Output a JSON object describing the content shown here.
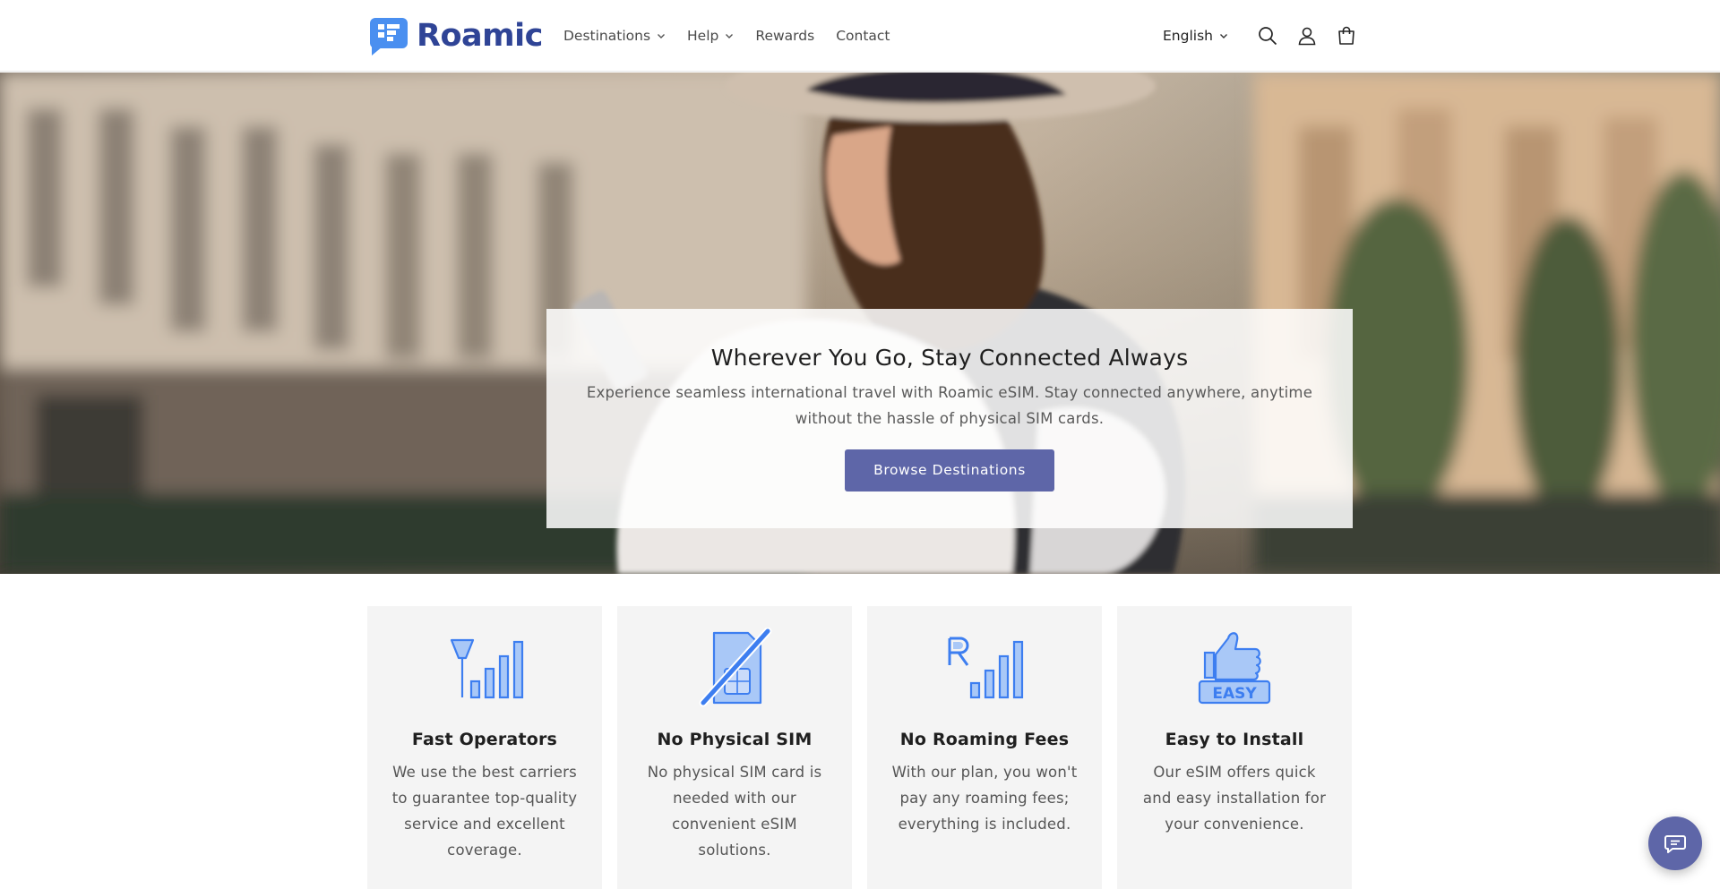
{
  "brand": {
    "name": "Roamic",
    "color": "#2f4496"
  },
  "nav": {
    "items": [
      {
        "label": "Destinations",
        "has_dropdown": true
      },
      {
        "label": "Help",
        "has_dropdown": true
      },
      {
        "label": "Rewards",
        "has_dropdown": false
      },
      {
        "label": "Contact",
        "has_dropdown": false
      }
    ]
  },
  "header": {
    "language": "English",
    "icons": [
      "search-icon",
      "account-icon",
      "cart-icon"
    ]
  },
  "hero": {
    "title": "Wherever You Go, Stay Connected Always",
    "subtitle": "Experience seamless international travel with Roamic eSIM. Stay connected anywhere, anytime without the hassle of physical SIM cards.",
    "cta_label": "Browse Destinations",
    "cta_color": "#5e66a8"
  },
  "features": [
    {
      "icon": "signal-antenna-icon",
      "title": "Fast Operators",
      "desc": "We use the best carriers to guarantee top-quality service and excellent coverage."
    },
    {
      "icon": "no-sim-icon",
      "title": "No Physical SIM",
      "desc": "No physical SIM card is needed with our convenient eSIM solutions."
    },
    {
      "icon": "roaming-signal-icon",
      "title": "No Roaming Fees",
      "desc": "With our plan, you won't pay any roaming fees; everything is included."
    },
    {
      "icon": "easy-thumbs-up-icon",
      "title": "Easy to Install",
      "desc": "Our eSIM offers quick and easy installation for your convenience."
    }
  ],
  "colors": {
    "icon_blue": "#3d7ef0",
    "icon_fill": "#a9c8f7",
    "card_bg": "#f4f4f4"
  },
  "chat": {
    "icon": "chat-icon"
  }
}
